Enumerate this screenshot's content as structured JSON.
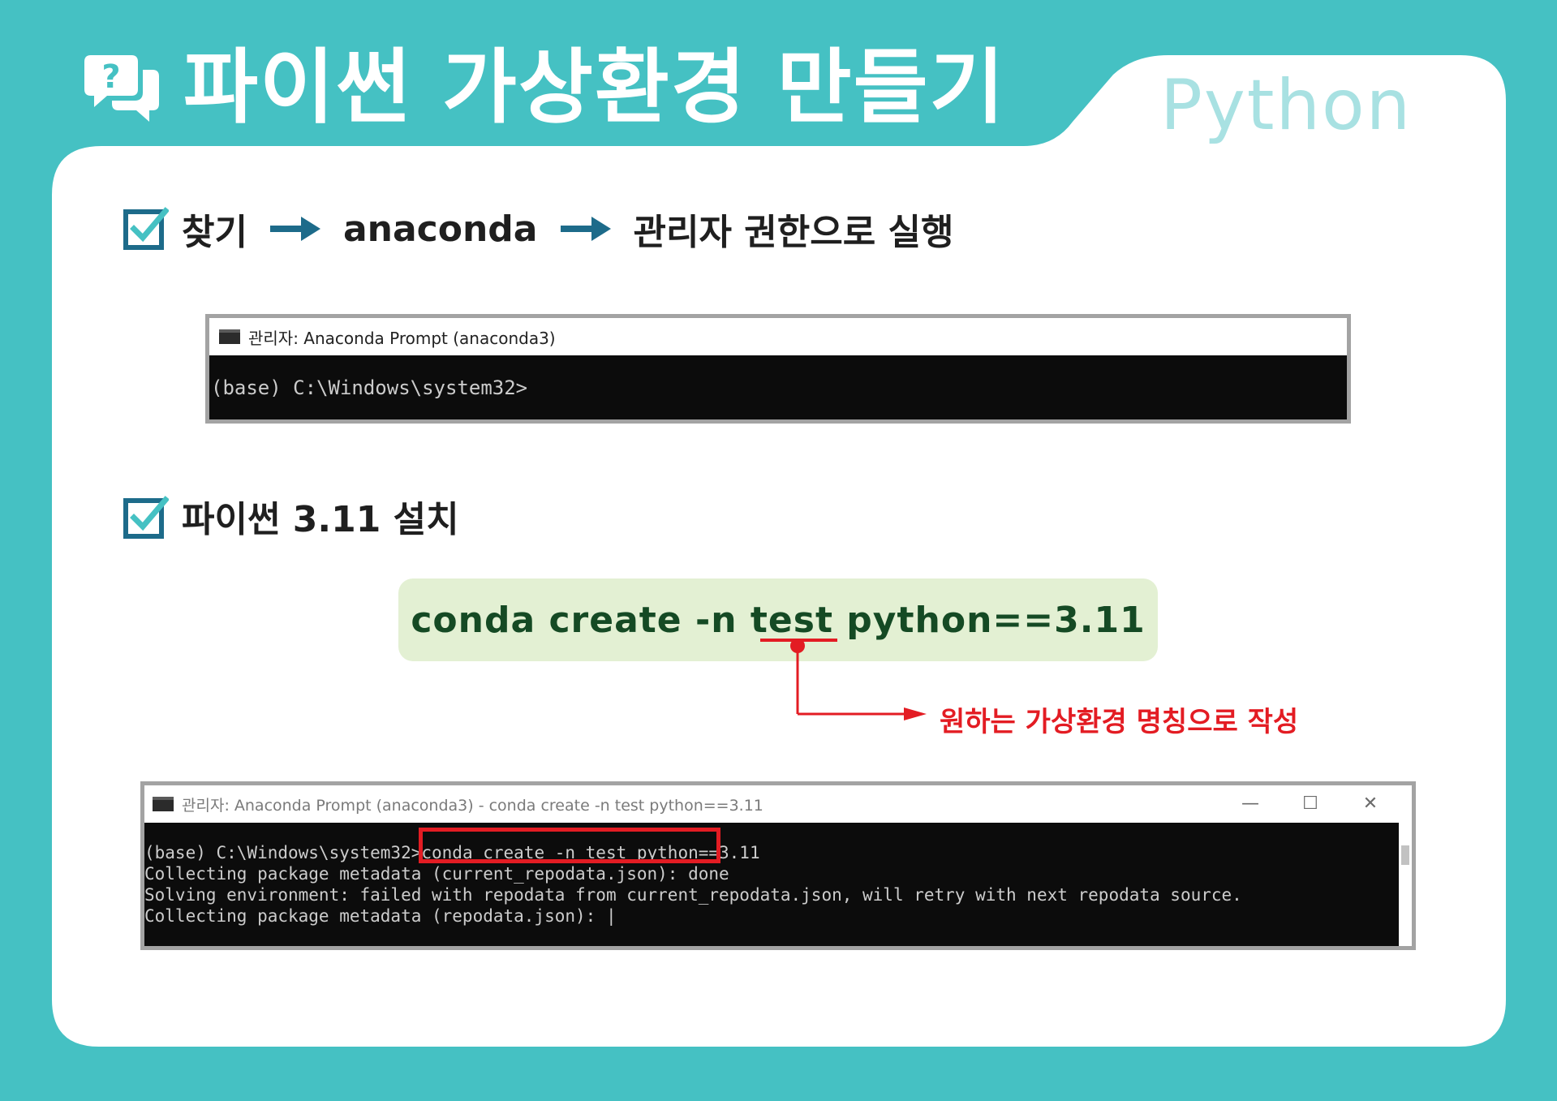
{
  "title": "파이썬 가상환경 만들기",
  "tab_label": "Python",
  "colors": {
    "background": "#45c1c3",
    "card": "#ffffff",
    "check": "#1d6b8a",
    "tab_text": "#a8e1e2",
    "command_box": "#e3f0d3",
    "command_text": "#154a24",
    "annotation": "#e31c23"
  },
  "step1": {
    "icon": "checkbox-checked-icon",
    "part1": "찾기",
    "part2": "anaconda",
    "part3": "관리자 권한으로 실행",
    "arrow_icon": "right-arrow-icon"
  },
  "terminal1": {
    "title": "관리자: Anaconda Prompt (anaconda3)",
    "line": "(base) C:\\Windows\\system32>"
  },
  "step2": {
    "icon": "checkbox-checked-icon",
    "text": "파이썬 3.11 설치"
  },
  "command": {
    "before": "conda create -n ",
    "highlight": "test",
    "after": " python==3.11"
  },
  "annotation": "원하는 가상환경 명칭으로 작성",
  "terminal2": {
    "title": "관리자: Anaconda Prompt (anaconda3) - conda  create -n test python==3.11",
    "prompt": "(base) C:\\Windows\\system32>",
    "command": "conda create -n test python==3.11",
    "lines": [
      "Collecting package metadata (current_repodata.json): done",
      "Solving environment: failed with repodata from current_repodata.json, will retry with next repodata source.",
      "Collecting package metadata (repodata.json): |"
    ],
    "buttons": {
      "minimize": "—",
      "maximize": "☐",
      "close": "✕"
    }
  }
}
